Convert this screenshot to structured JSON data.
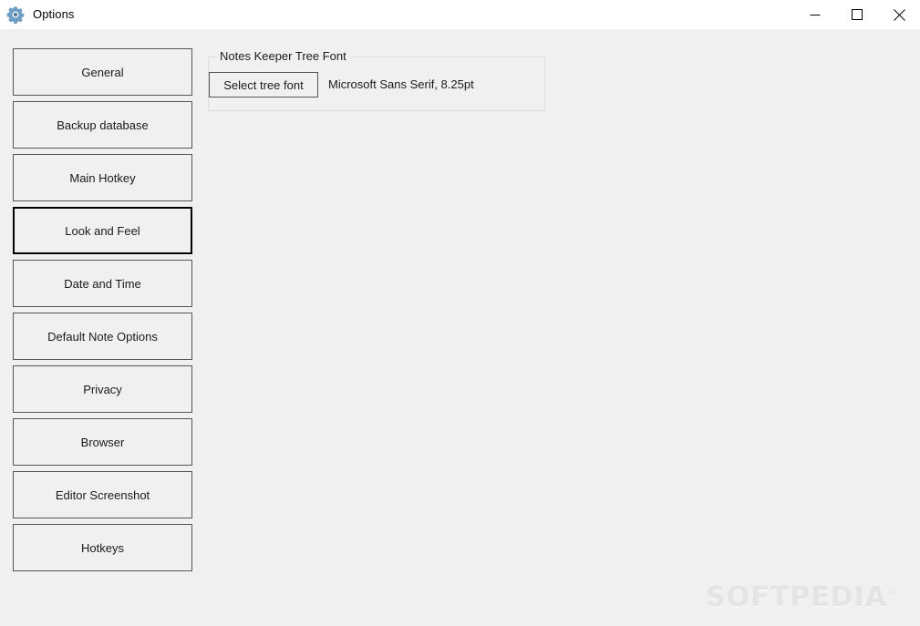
{
  "window": {
    "title": "Options",
    "icon": "gear-icon",
    "titlebar_bg": "#ffffff",
    "client_bg": "#f0f0f0",
    "icon_color": "#5b8db8",
    "controls": [
      {
        "name": "minimize-button",
        "glyph": "minimize"
      },
      {
        "name": "maximize-button",
        "glyph": "maximize"
      },
      {
        "name": "close-button",
        "glyph": "close"
      }
    ]
  },
  "sidebar": {
    "items": [
      {
        "label": "General",
        "selected": false
      },
      {
        "label": "Backup database",
        "selected": false
      },
      {
        "label": "Main Hotkey",
        "selected": false
      },
      {
        "label": "Look and Feel",
        "selected": true
      },
      {
        "label": "Date and Time",
        "selected": false
      },
      {
        "label": "Default Note Options",
        "selected": false
      },
      {
        "label": "Privacy",
        "selected": false
      },
      {
        "label": "Browser",
        "selected": false
      },
      {
        "label": "Editor Screenshot",
        "selected": false
      },
      {
        "label": "Hotkeys",
        "selected": false
      }
    ]
  },
  "panel": {
    "groupbox": {
      "legend": "Notes Keeper Tree Font",
      "select_font_button": "Select tree font",
      "font_value": "Microsoft Sans Serif, 8.25pt"
    }
  },
  "watermark": {
    "text": "SOFTPEDIA",
    "mark": "®"
  }
}
